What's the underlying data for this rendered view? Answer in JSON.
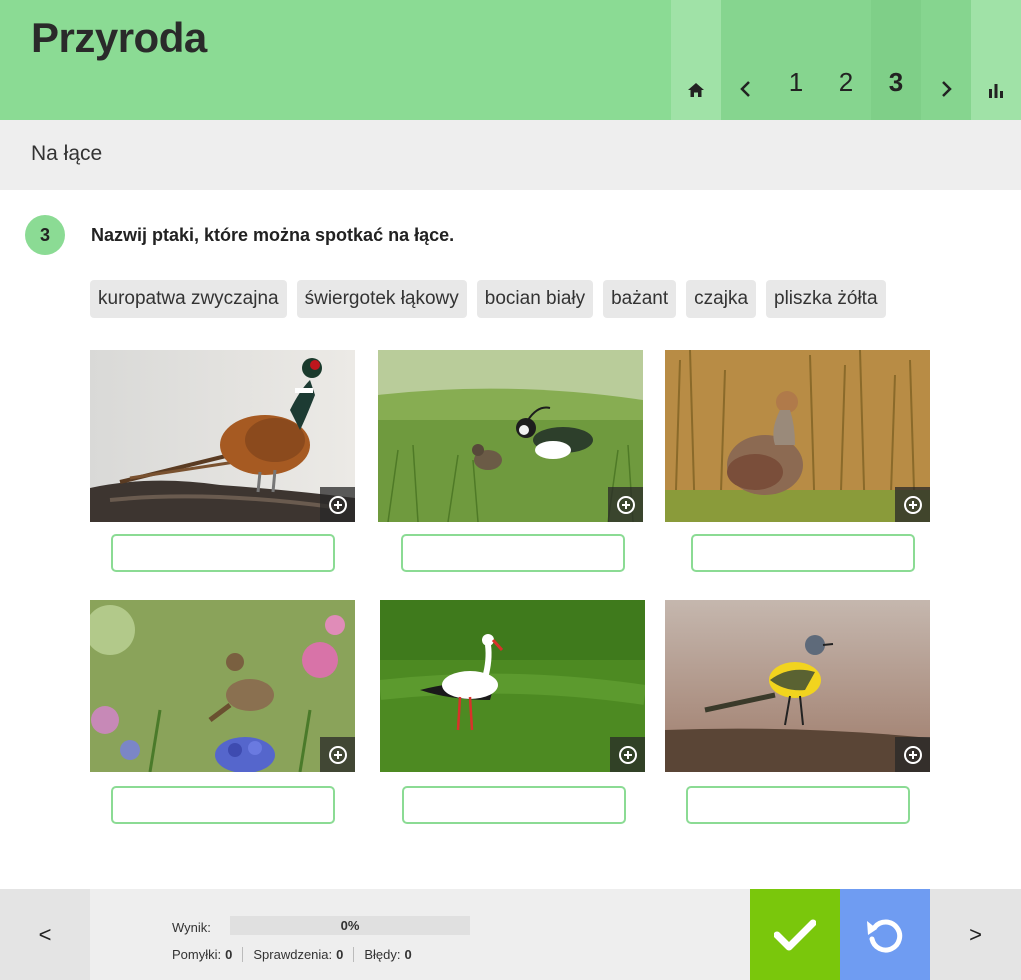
{
  "header": {
    "title": "Przyroda"
  },
  "nav": {
    "home_icon": "home-icon",
    "prev_icon": "chevron-left-icon",
    "pages": [
      "1",
      "2",
      "3"
    ],
    "current_page": "3",
    "next_icon": "chevron-right-icon",
    "stats_icon": "bar-chart-icon"
  },
  "section": {
    "title": "Na łące"
  },
  "task": {
    "number": "3",
    "instruction": "Nazwij ptaki, które można spotkać na łące.",
    "word_bank": [
      "kuropatwa zwyczajna",
      "świergotek łąkowy",
      "bocian biały",
      "bażant",
      "czajka",
      "pliszka żółta"
    ],
    "images": [
      {
        "subject": "pheasant",
        "answer": ""
      },
      {
        "subject": "lapwing",
        "answer": ""
      },
      {
        "subject": "partridge",
        "answer": ""
      },
      {
        "subject": "meadow pipit",
        "answer": ""
      },
      {
        "subject": "white stork",
        "answer": ""
      },
      {
        "subject": "yellow wagtail",
        "answer": ""
      }
    ]
  },
  "footer": {
    "prev_label": "<",
    "next_label": ">",
    "score_label": "Wynik:",
    "score_value": "0%",
    "score_fraction": 0,
    "mistakes_label": "Pomyłki:",
    "mistakes_value": "0",
    "checks_label": "Sprawdzenia:",
    "checks_value": "0",
    "errors_label": "Błędy:",
    "errors_value": "0",
    "check_icon": "checkmark-icon",
    "reset_icon": "reset-icon"
  },
  "colors": {
    "header_green": "#8bdb94",
    "check_green": "#7ac70c",
    "reset_blue": "#6f9cf2"
  }
}
